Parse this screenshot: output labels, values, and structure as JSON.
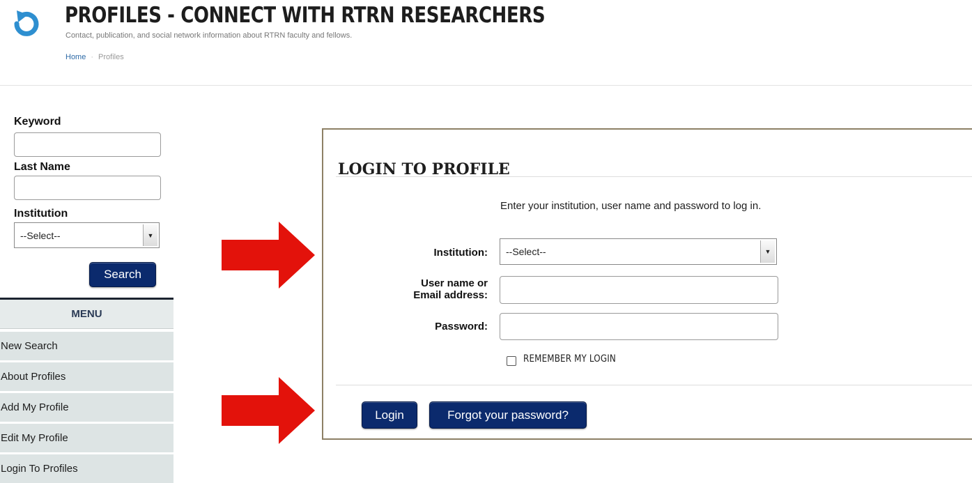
{
  "header": {
    "title": "PROFILES - CONNECT WITH RTRN RESEARCHERS",
    "subtitle": "Contact, publication, and social network information about RTRN faculty and fellows.",
    "breadcrumb": {
      "home": "Home",
      "current": "Profiles"
    }
  },
  "sidebar": {
    "keyword_label": "Keyword",
    "keyword_value": "",
    "lastname_label": "Last Name",
    "lastname_value": "",
    "institution_label": "Institution",
    "institution_value": "--Select--",
    "search_button": "Search",
    "menu_title": "MENU",
    "menu_items": [
      "New Search",
      "About Profiles",
      "Add My Profile",
      "Edit My Profile",
      "Login To Profiles"
    ]
  },
  "login": {
    "title": "LOGIN TO PROFILE",
    "instructions": "Enter your institution, user name and password to log in.",
    "institution_label": "Institution:",
    "institution_value": "--Select--",
    "username_label_line1": "User name or",
    "username_label_line2": "Email address:",
    "username_value": "",
    "password_label": "Password:",
    "password_value": "",
    "remember_label": "REMEMBER MY LOGIN",
    "remember_checked": false,
    "login_button": "Login",
    "forgot_button": "Forgot your password?"
  },
  "colors": {
    "navy_button": "#0b2a6d",
    "link": "#2e6aa7",
    "logo": "#2e8fd0",
    "annotation_arrow": "#e3120b",
    "panel_border": "#8d8065",
    "menu_bg": "#dde4e4"
  },
  "icons": {
    "logo": "circular-arrow-logo-icon",
    "annotation": "red-arrow-icon",
    "dropdown": "chevron-down-icon"
  }
}
